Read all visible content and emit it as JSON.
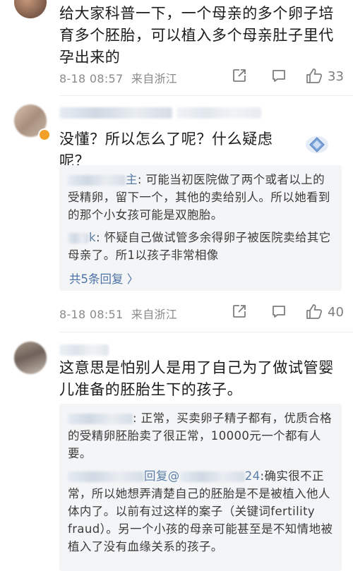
{
  "comments": [
    {
      "text": "给大家科普一下，一个母亲的多个卵子培育多个胚胎，可以植入多个母亲肚子里代孕出来的",
      "time": "8-18 08:57",
      "location": "来自浙江",
      "likes": "33"
    },
    {
      "text": "没懂？所以怎么了呢？什么疑虑呢？",
      "time": "8-18 08:51",
      "location": "来自浙江",
      "likes": "40",
      "replies": [
        {
          "name_suffix": "主",
          "text": ": 可能当初医院做了两个或者以上的受精卵，留下一个，其他的卖给别人。所以她看到的那个小女孩可能是双胞胎。"
        },
        {
          "name_suffix": "k",
          "text": ": 怀疑自己做试管多余得卵子被医院卖给其它母亲了。所1以孩子非常相像"
        }
      ],
      "more_replies": "共5条回复 〉"
    },
    {
      "text": "这意思是怕别人是用了自己为了做试管婴儿准备的胚胎生下的孩子。",
      "replies": [
        {
          "name_suffix": "",
          "text": ": 正常，买卖卵子精子都有，优质合格的受精卵胚胎卖了很正常，10000元一个都有人要。"
        },
        {
          "name_suffix": "回复@",
          "name_tail": "24",
          "text": ":确实很不正常，所以她想弄清楚自己的胚胎是不是被植入他人体内了。以前有过这样的案子（关键词fertility fraud）。另一个小孩的母亲可能甚至是不知情地被植入了没有血缘关系的孩子。"
        }
      ]
    }
  ],
  "colors": {
    "link": "#4c73a6",
    "meta": "#8a8a8a",
    "reply_bg": "#f4f5f7"
  },
  "icons": [
    "share-icon",
    "comment-icon",
    "like-icon",
    "vip-diamond-icon"
  ]
}
